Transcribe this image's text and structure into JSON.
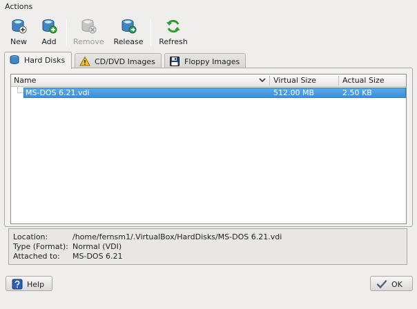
{
  "menubar": {
    "actions_label": "Actions"
  },
  "toolbar": {
    "new_label": "New",
    "add_label": "Add",
    "remove_label": "Remove",
    "release_label": "Release",
    "refresh_label": "Refresh"
  },
  "tabs": [
    {
      "label": "Hard Disks",
      "icon": "hard-disk-icon",
      "active": true
    },
    {
      "label": "CD/DVD Images",
      "icon": "warning-icon",
      "active": false
    },
    {
      "label": "Floppy Images",
      "icon": "floppy-icon",
      "active": false
    }
  ],
  "table": {
    "columns": [
      "Name",
      "Virtual Size",
      "Actual Size"
    ],
    "rows": [
      {
        "name": "MS-DOS 6.21.vdi",
        "virtual_size": "512.00 MB",
        "actual_size": "2.50 KB",
        "selected": true
      }
    ]
  },
  "info": {
    "location_label": "Location:",
    "location_value": "/home/fernsm1/.VirtualBox/HardDisks/MS-DOS 6.21.vdi",
    "type_label": "Type (Format):",
    "type_value": "Normal (VDI)",
    "attached_label": "Attached to:",
    "attached_value": "MS-DOS 6.21"
  },
  "buttons": {
    "help_label": "Help",
    "ok_label": "OK"
  },
  "colors": {
    "selection": "#3d8fd8",
    "background": "#efeeec"
  }
}
